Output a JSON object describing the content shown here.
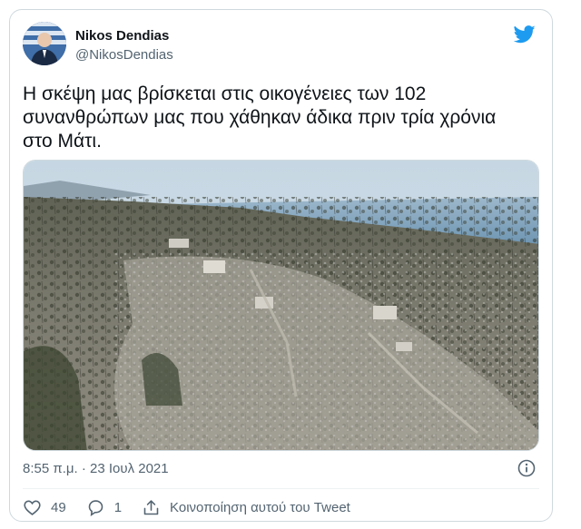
{
  "user": {
    "name": "Nikos Dendias",
    "handle": "@NikosDendias"
  },
  "tweet": {
    "text": "Η σκέψη μας βρίσκεται στις οικογένειες των 102\nσυνανθρώπων μας που χάθηκαν άδικα πριν τρία χρόνια\nστο Μάτι.",
    "timestamp": "8:55 π.μ. · 23 Ιουλ 2021"
  },
  "actions": {
    "likes": "49",
    "replies": "1",
    "share_label": "Κοινοποίηση αυτού του Tweet"
  },
  "icons": {
    "brand": "twitter-bird-icon",
    "info": "info-icon",
    "like": "heart-icon",
    "reply": "reply-icon",
    "share": "share-icon"
  },
  "colors": {
    "brand": "#1d9bf0",
    "text": "#0f1419",
    "muted": "#536471",
    "border": "#cfd9de"
  }
}
